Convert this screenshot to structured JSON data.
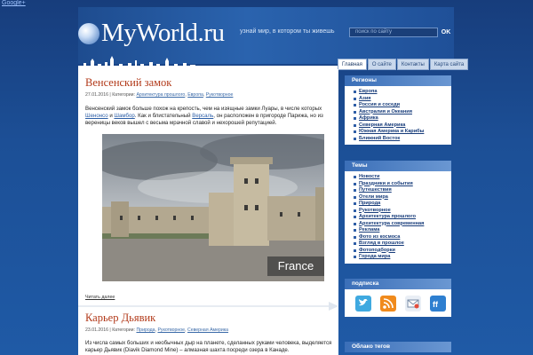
{
  "google_link": "Google+",
  "header": {
    "logo_text": "MyWorld.ru",
    "tagline": "узнай мир, в котором ты живешь",
    "search_placeholder": "поиск по сайту",
    "search_button": "OK"
  },
  "tabs": [
    {
      "label": "Главная",
      "active": true
    },
    {
      "label": "О сайте",
      "active": false
    },
    {
      "label": "Контакты",
      "active": false
    },
    {
      "label": "Карта сайта",
      "active": false
    }
  ],
  "posts": [
    {
      "title": "Венсенский замок",
      "date": "27.01.2016",
      "cat_prefix": "| Категории:",
      "categories": [
        "Архитектура прошлого",
        "Европа",
        "Рукотворное"
      ],
      "text_1": "Венсенский замок больше похож на крепость, чем на изящные замки Луары, в числе которых",
      "text_link_1": "Шенонсо",
      "text_2": "и",
      "text_link_2": "Шамбор",
      "text_3": ". Как и блистательный",
      "text_link_3": "Версаль",
      "text_4": ", он расположен в пригороде Парижа, но из вереницы веков вышел с весьма мрачной славой и нехорошей репутацией.",
      "image_label": "France",
      "read_more": "Читать далее"
    },
    {
      "title": "Карьер Дьявик",
      "date": "23.01.2016",
      "cat_prefix": "| Категории:",
      "categories": [
        "Природа",
        "Рукотворное",
        "Северная Америка"
      ],
      "text": "Из числа самых больших и необычных дыр на планете, сделанных руками человека, выделяется карьер Дьявик (Diavik Diamond Mine) – алмазная шахта посреди озера в Канаде."
    }
  ],
  "sidebar": {
    "regions": {
      "title": "Регионы",
      "items": [
        "Европа",
        "Азия",
        "Россия и соседи",
        "Австралия и Океания",
        "Африка",
        "Северная Америка",
        "Южная Америка и Карибы",
        "Ближний Восток"
      ]
    },
    "topics": {
      "title": "Темы",
      "items": [
        "Новости",
        "Праздники и события",
        "Путешествия",
        "Отели мира",
        "Природа",
        "Рукотворное",
        "Архитектура прошлого",
        "Архитектура современная",
        "Реклама",
        "Фото из космоса",
        "Взгляд в прошлое",
        "Фотоподборки",
        "Города мира"
      ]
    },
    "subscribe": {
      "title": "подписка",
      "icons": [
        "twitter-icon",
        "rss-icon",
        "email-icon",
        "friendfeed-icon"
      ]
    },
    "tags": {
      "title": "Облако тегов"
    }
  },
  "colors": {
    "background": "#1c4f96",
    "title_red": "#b23a1a",
    "link_blue": "#2c5ea6",
    "widget_head": "#3b6fb8"
  }
}
